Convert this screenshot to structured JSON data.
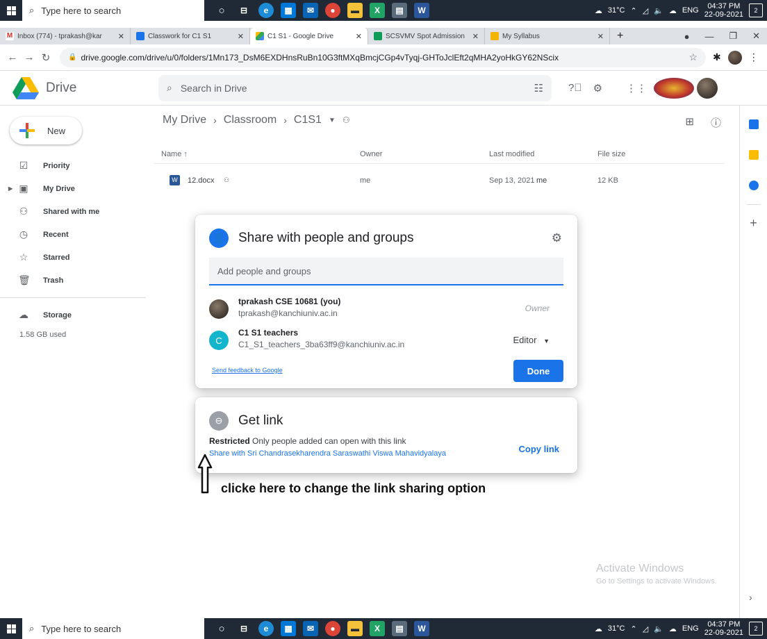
{
  "taskbar": {
    "search_placeholder": "Type here to search",
    "weather": "31°C",
    "lang": "ENG",
    "time": "04:37 PM",
    "date": "22-09-2021",
    "notifications": "2"
  },
  "tabs": [
    {
      "label": "Inbox (774) - tprakash@kar",
      "color": "#d93025"
    },
    {
      "label": "Classwork for C1 S1",
      "color": "#1a73e8"
    },
    {
      "label": "C1 S1 - Google Drive",
      "color": "#0f9d58"
    },
    {
      "label": "SCSVMV Spot Admission",
      "color": "#0f9d58"
    },
    {
      "label": "My Syllabus",
      "color": "#f4b400"
    }
  ],
  "address": {
    "url": "drive.google.com/drive/u/0/folders/1Mn173_DsM6EXDHnsRuBn10G3ftMXqBmcjCGp4vTyqj-GHToJclEft2qMHA2yoHkGY62NScix"
  },
  "drive": {
    "app_name": "Drive",
    "search_placeholder": "Search in Drive",
    "new_label": "New",
    "nav": [
      {
        "label": "Priority",
        "icon": "✓"
      },
      {
        "label": "My Drive",
        "icon": "▣"
      },
      {
        "label": "Shared with me",
        "icon": "👥"
      },
      {
        "label": "Recent",
        "icon": "◷"
      },
      {
        "label": "Starred",
        "icon": "☆"
      },
      {
        "label": "Trash",
        "icon": "🗑"
      }
    ],
    "storage_label": "Storage",
    "storage_used": "1.58 GB used",
    "breadcrumb": [
      "My Drive",
      "Classroom",
      "C1S1"
    ],
    "columns": {
      "name": "Name",
      "owner": "Owner",
      "modified": "Last modified",
      "size": "File size"
    },
    "files": [
      {
        "name": "12.docx",
        "owner": "me",
        "modified": "Sep 13, 2021",
        "modified_by": "me",
        "size": "12 KB"
      }
    ]
  },
  "share_dialog": {
    "title": "Share with people and groups",
    "input_placeholder": "Add people and groups",
    "people": [
      {
        "name": "tprakash CSE 10681 (you)",
        "email": "tprakash@kanchiuniv.ac.in",
        "role": "Owner"
      },
      {
        "name": "C1 S1 teachers",
        "email": "C1_S1_teachers_3ba63ff9@kanchiuniv.ac.in",
        "role": "Editor",
        "initial": "C"
      }
    ],
    "feedback": "Send feedback to Google",
    "done": "Done"
  },
  "link_dialog": {
    "title": "Get link",
    "restricted_bold": "Restricted",
    "restricted_text": "Only people added can open with this link",
    "share_with_org": "Share with Sri Chandrasekharendra Saraswathi Viswa Mahavidyalaya",
    "copy_link": "Copy link"
  },
  "annotation": "clicke here to change the link sharing option",
  "watermark": {
    "line1": "Activate Windows",
    "line2": "Go to Settings to activate Windows."
  }
}
